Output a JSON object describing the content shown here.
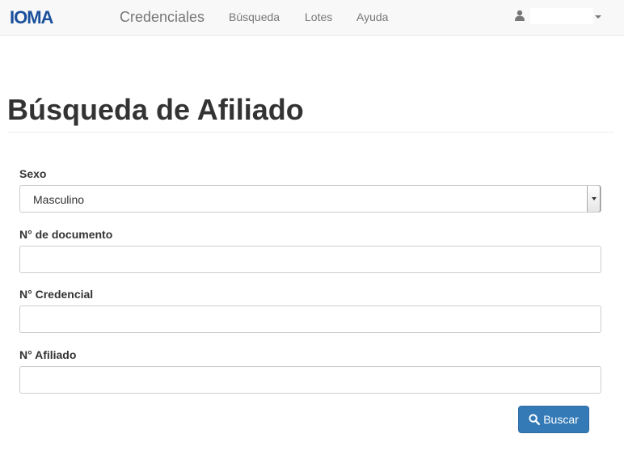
{
  "navbar": {
    "logo_text": "IOMA",
    "brand": "Credenciales",
    "links": [
      "Búsqueda",
      "Lotes",
      "Ayuda"
    ],
    "user_icon": "user-icon",
    "colors": {
      "logo": "#1a4f9c",
      "background": "#f8f8f8",
      "link": "#777777"
    }
  },
  "page": {
    "title": "Búsqueda de Afiliado"
  },
  "form": {
    "sexo": {
      "label": "Sexo",
      "value": "Masculino"
    },
    "documento": {
      "label": "N° de documento",
      "value": ""
    },
    "credencial": {
      "label": "N° Credencial",
      "value": ""
    },
    "afiliado": {
      "label": "N° Afiliado",
      "value": ""
    },
    "submit": {
      "label": "Buscar",
      "icon": "search-icon",
      "color": "#337ab7"
    }
  }
}
